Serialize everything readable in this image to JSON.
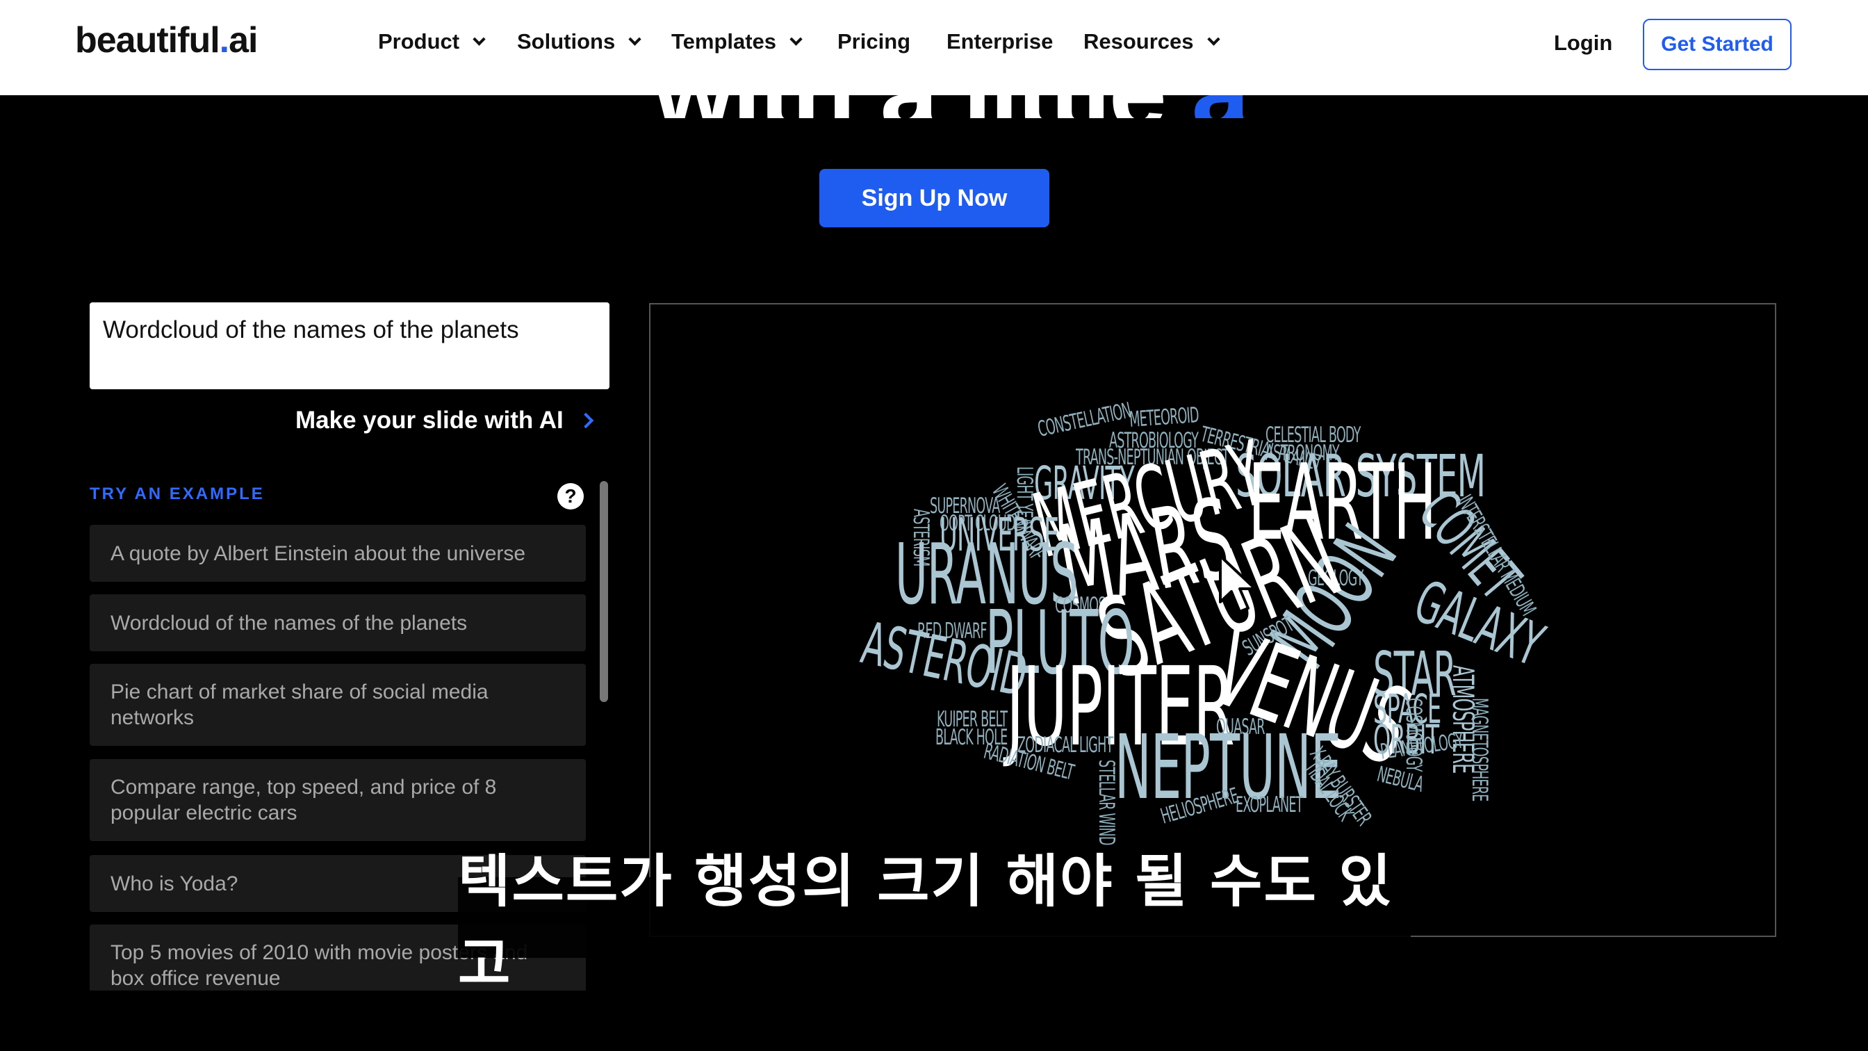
{
  "nav": {
    "logo_main": "beautiful",
    "logo_dot": ".",
    "logo_ai": "ai",
    "menu": [
      {
        "label": "Product",
        "dropdown": true
      },
      {
        "label": "Solutions",
        "dropdown": true
      },
      {
        "label": "Templates",
        "dropdown": true
      },
      {
        "label": "Pricing",
        "dropdown": false
      },
      {
        "label": "Enterprise",
        "dropdown": false
      },
      {
        "label": "Resources",
        "dropdown": true
      }
    ],
    "login": "Login",
    "get_started": "Get Started"
  },
  "hero": {
    "headline_part": "with a little ",
    "headline_accent": "ai.",
    "signup": "Sign Up Now"
  },
  "prompt": {
    "value": "Wordcloud of the names of the planets",
    "make_slide": "Make your slide with AI"
  },
  "examples": {
    "label": "TRY AN EXAMPLE",
    "help_icon": "question-circle-icon",
    "items": [
      "A quote by Albert Einstein about the universe",
      "Wordcloud of the names of the planets",
      "Pie chart of market share of social media networks",
      "Compare range, top speed, and price of 8 popular electric cars",
      "Who is Yoda?",
      "Top 5 movies of 2010 with movie posters and box office revenue"
    ]
  },
  "wordcloud": {
    "words": [
      {
        "text": "CONSTELLATION"
      },
      {
        "text": "METEOROID"
      },
      {
        "text": "ASTROBIOLOGY"
      },
      {
        "text": "TERRESTRIAL PLANET"
      },
      {
        "text": "CELESTIAL BODY"
      },
      {
        "text": "ASTRONOMY"
      },
      {
        "text": "TRANS-NEPTUNIAN OBJECT"
      },
      {
        "text": "LIGHT YEAR"
      },
      {
        "text": "GRAVITY"
      },
      {
        "text": "SOLAR SYSTEM"
      },
      {
        "text": "WHITE DWARF"
      },
      {
        "text": "SUPERNOVA"
      },
      {
        "text": "OORT CLOUD"
      },
      {
        "text": "MERCURY"
      },
      {
        "text": "EARTH"
      },
      {
        "text": "COMET"
      },
      {
        "text": "INTERSTELLAR MEDIUM"
      },
      {
        "text": "ASTERISM"
      },
      {
        "text": "UNIVERSE"
      },
      {
        "text": "MARS"
      },
      {
        "text": "URANUS"
      },
      {
        "text": "COSMOS"
      },
      {
        "text": "GEOLOGY"
      },
      {
        "text": "MOON"
      },
      {
        "text": "GALAXY"
      },
      {
        "text": "SATURN"
      },
      {
        "text": "RED DWARF"
      },
      {
        "text": "PLUTO"
      },
      {
        "text": "SUNSPOT"
      },
      {
        "text": "ASTEROID"
      },
      {
        "text": "STAR"
      },
      {
        "text": "ATMOSPHERE"
      },
      {
        "text": "JUPITER"
      },
      {
        "text": "VENUS"
      },
      {
        "text": "SPACE"
      },
      {
        "text": "ORBIT"
      },
      {
        "text": "KUIPER BELT"
      },
      {
        "text": "BLACK HOLE"
      },
      {
        "text": "QUASAR"
      },
      {
        "text": "COSMOLOGY"
      },
      {
        "text": "MAGNETOSPHERE"
      },
      {
        "text": "ZODIACAL LIGHT"
      },
      {
        "text": "NEPTUNE"
      },
      {
        "text": "PLANETOLOGY"
      },
      {
        "text": "RADIATION BELT"
      },
      {
        "text": "X-RAY BURSTER"
      },
      {
        "text": "STELLAR WIND"
      },
      {
        "text": "TIDAL LOCK"
      },
      {
        "text": "NEBULA"
      },
      {
        "text": "HELIOSPHERE"
      },
      {
        "text": "EXOPLANET"
      }
    ],
    "colors": {
      "bright": "#ffffff",
      "mid": "#a9c6d2",
      "dim": "#8fb0bd"
    }
  },
  "subtitle": "텍스트가 행성의 크기 해야 될 수도 있고",
  "colors": {
    "accent": "#1f5cf0",
    "background": "#000000"
  }
}
